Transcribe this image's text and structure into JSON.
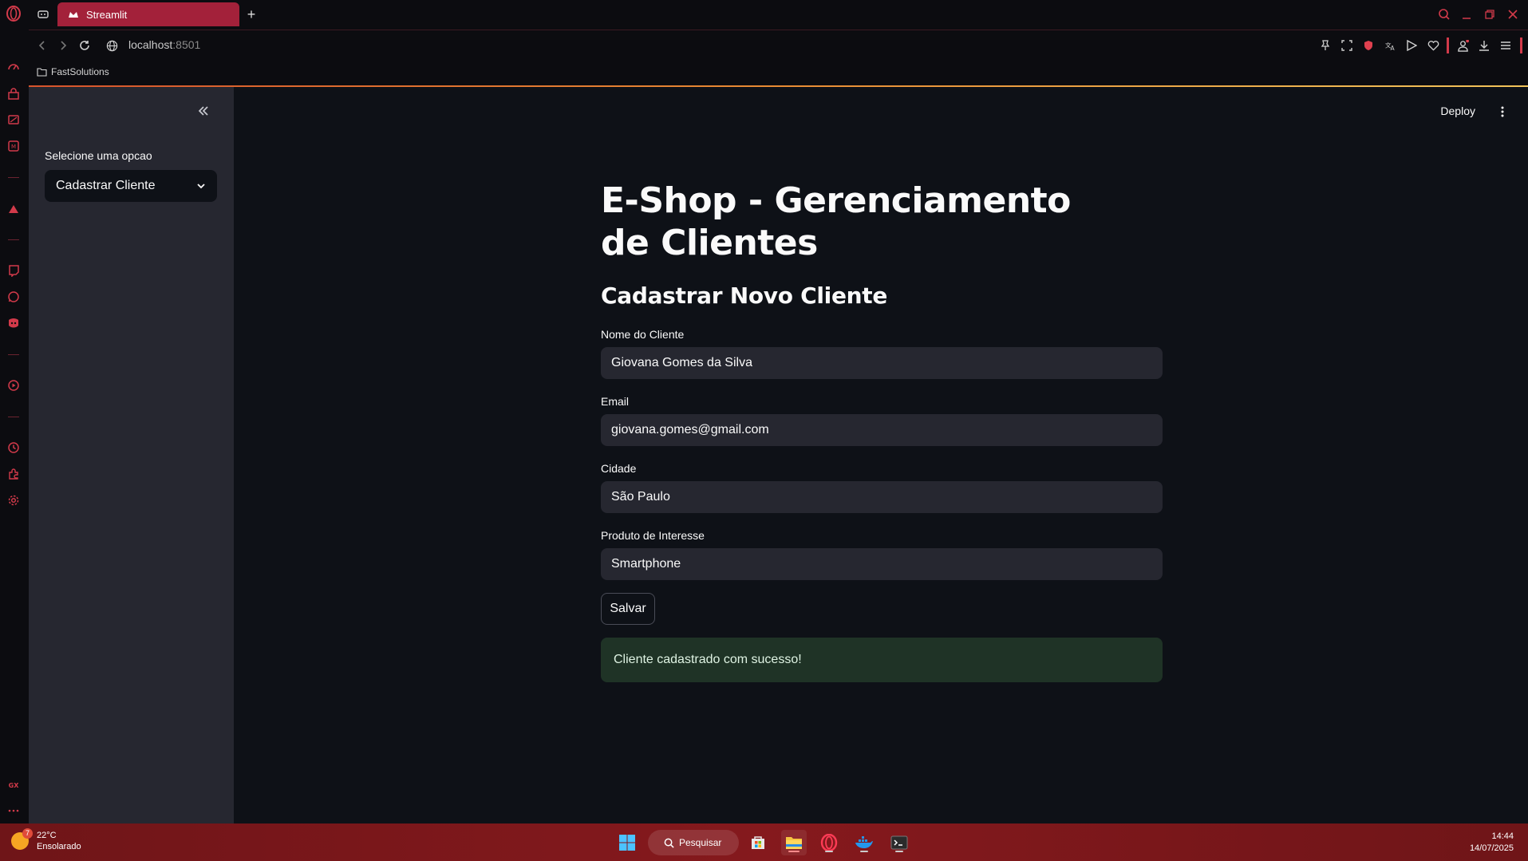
{
  "browser": {
    "tab_title": "Streamlit",
    "url_host": "localhost",
    "url_port": ":8501",
    "bookmark_folder": "FastSolutions",
    "new_tab_symbol": "+"
  },
  "sidebar": {
    "select_label": "Selecione uma opcao",
    "select_value": "Cadastrar Cliente"
  },
  "header": {
    "deploy_label": "Deploy"
  },
  "main": {
    "title": "E-Shop - Gerenciamento de Clientes",
    "subtitle": "Cadastrar Novo Cliente",
    "fields": [
      {
        "label": "Nome do Cliente",
        "value": "Giovana Gomes da Silva"
      },
      {
        "label": "Email",
        "value": "giovana.gomes@gmail.com"
      },
      {
        "label": "Cidade",
        "value": "São Paulo"
      },
      {
        "label": "Produto de Interesse",
        "value": "Smartphone"
      }
    ],
    "save_label": "Salvar",
    "success_message": "Cliente cadastrado com sucesso!"
  },
  "taskbar": {
    "weather_temp": "22°C",
    "weather_desc": "Ensolarado",
    "weather_badge": "7",
    "search_label": "Pesquisar",
    "time": "14:44",
    "date": "14/07/2025"
  },
  "colors": {
    "accent": "#a3213a",
    "app_bg": "#0e1117",
    "sidebar_bg": "#262730",
    "input_bg": "#262730",
    "success_bg": "#1f3326",
    "taskbar": "#85191d"
  }
}
